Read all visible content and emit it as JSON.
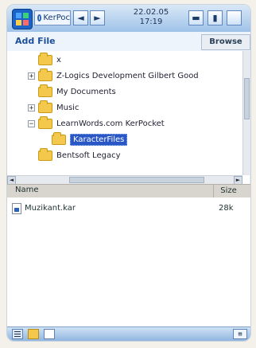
{
  "topbar": {
    "app_tab_label": "KerPoc",
    "date": "22.02.05",
    "time": "17:19",
    "btn_left": "◄",
    "btn_right": "►",
    "status_btn": "▬",
    "signal_btn": "▮"
  },
  "toolbar": {
    "add_file_label": "Add File",
    "browse_label": "Browse"
  },
  "tree": {
    "nodes": [
      {
        "label": "x",
        "expander": ""
      },
      {
        "label": "Z-Logics Development Gilbert Good",
        "expander": "+"
      },
      {
        "label": "My Documents",
        "expander": ""
      },
      {
        "label": "Music",
        "expander": "+"
      },
      {
        "label": "LearnWords.com KerPocket",
        "expander": "−"
      },
      {
        "label": "KaracterFiles",
        "expander": ""
      },
      {
        "label": "Bentsoft Legacy",
        "expander": ""
      }
    ]
  },
  "hscroll": {
    "left_arrow": "◄",
    "right_arrow": "►"
  },
  "list": {
    "columns": {
      "name": "Name",
      "size": "Size"
    },
    "rows": [
      {
        "name": "Muzikant.kar",
        "size": "28k"
      }
    ]
  },
  "bottombar": {
    "keyboard_label": "▤"
  }
}
